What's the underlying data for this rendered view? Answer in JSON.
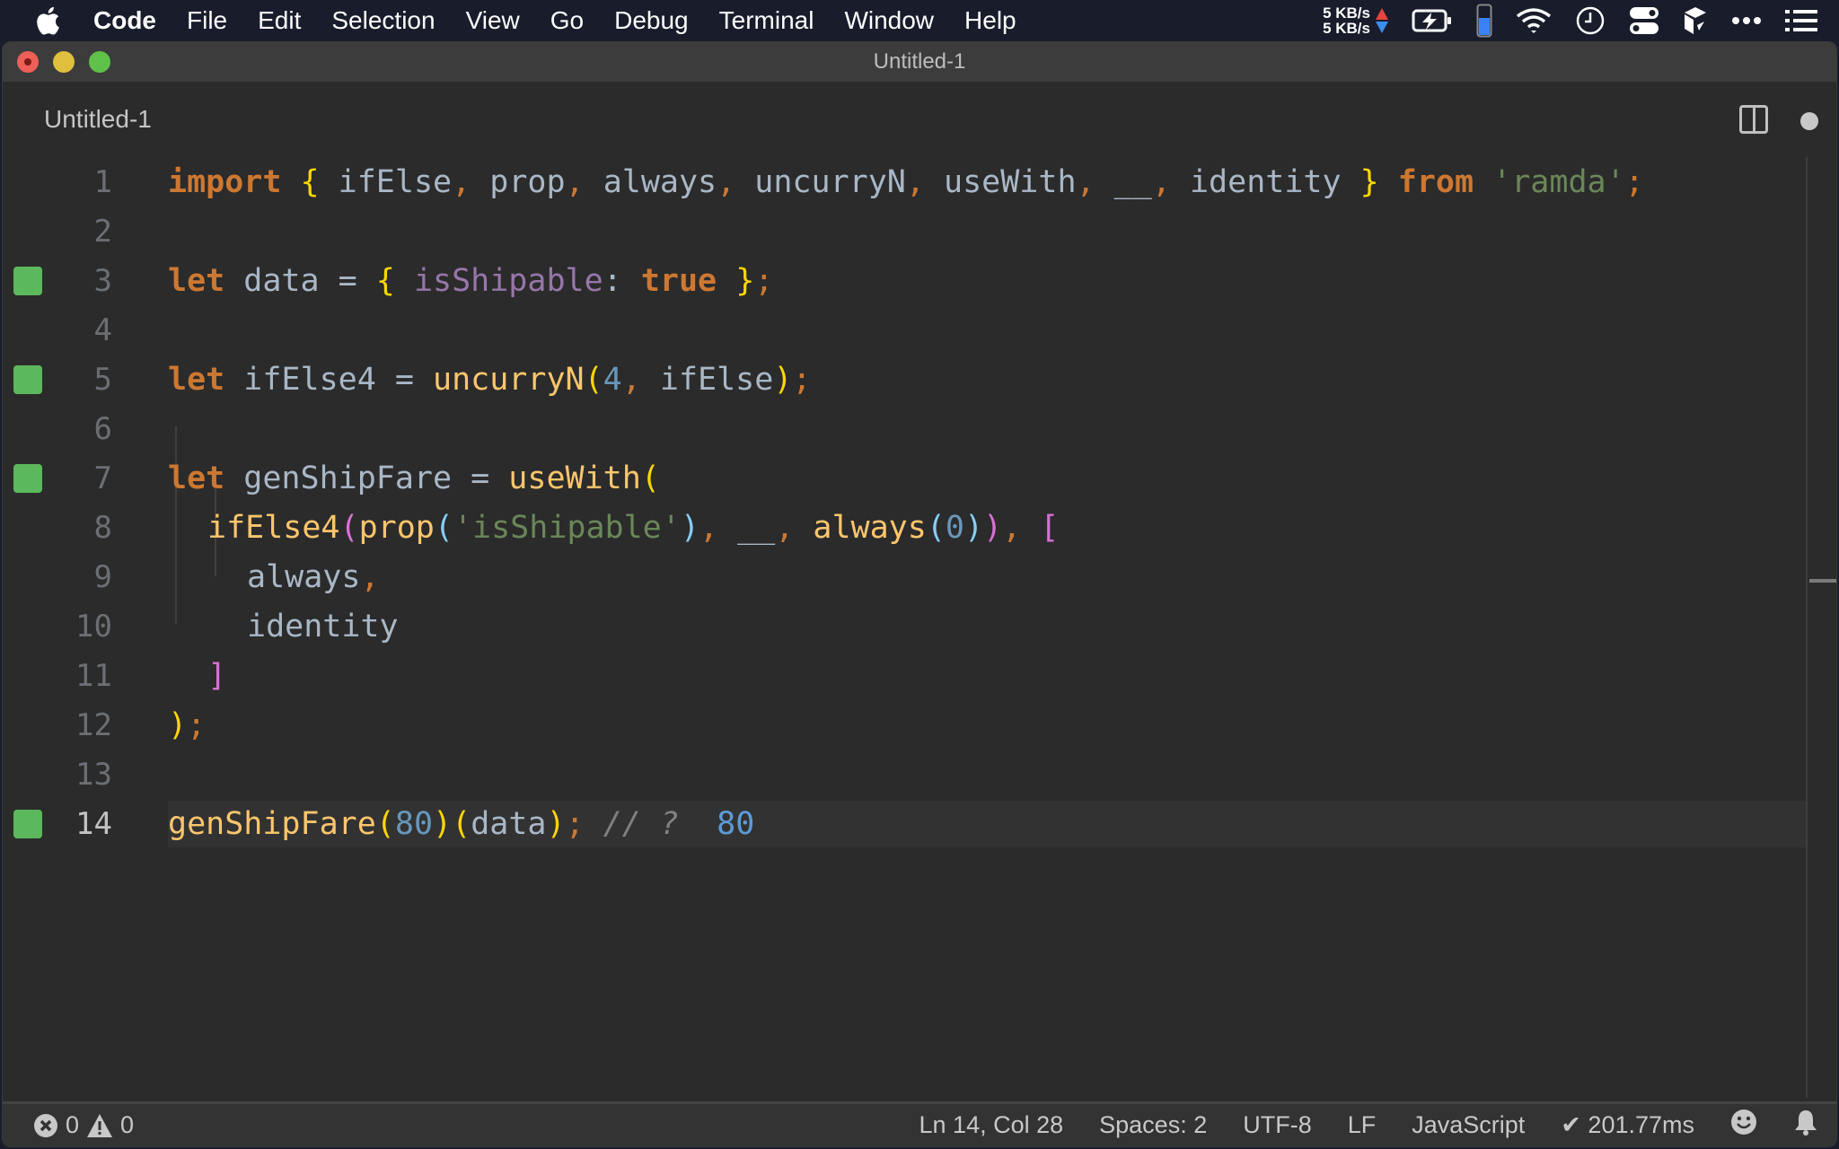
{
  "menubar": {
    "app_name": "Code",
    "items": [
      "File",
      "Edit",
      "Selection",
      "View",
      "Go",
      "Debug",
      "Terminal",
      "Window",
      "Help"
    ],
    "net_up": "5 KB/s",
    "net_down": "5 KB/s",
    "status_icons": [
      "battery-charging-icon",
      "cpu-meter-icon",
      "wifi-icon",
      "clock-icon",
      "control-center-icon",
      "app-icon",
      "more-icon",
      "list-icon"
    ]
  },
  "window": {
    "title": "Untitled-1",
    "tab_label": "Untitled-1"
  },
  "editor": {
    "lines": [
      {
        "n": "1"
      },
      {
        "n": "2"
      },
      {
        "n": "3"
      },
      {
        "n": "4"
      },
      {
        "n": "5"
      },
      {
        "n": "6"
      },
      {
        "n": "7"
      },
      {
        "n": "8"
      },
      {
        "n": "9"
      },
      {
        "n": "10"
      },
      {
        "n": "11"
      },
      {
        "n": "12"
      },
      {
        "n": "13"
      },
      {
        "n": "14"
      }
    ],
    "tokens": {
      "l1": [
        "import",
        " ",
        "{",
        " ifElse",
        ",",
        " prop",
        ",",
        " always",
        ",",
        " uncurryN",
        ",",
        " useWith",
        ",",
        " __",
        ",",
        " identity ",
        "}",
        " ",
        "from",
        " ",
        "'ramda'",
        ";"
      ],
      "l3": [
        "let",
        " data = ",
        "{",
        " ",
        "isShipable",
        ": ",
        "true",
        " ",
        "}",
        ";"
      ],
      "l5": [
        "let",
        " ifElse4 = ",
        "uncurryN",
        "(",
        "4",
        ",",
        " ifElse",
        ")",
        ";"
      ],
      "l7": [
        "let",
        " genShipFare = ",
        "useWith",
        "("
      ],
      "l8": [
        "ifElse4",
        "(",
        "prop",
        "(",
        "'isShipable'",
        ")",
        ",",
        " __",
        ",",
        " ",
        "always",
        "(",
        "0",
        ")",
        ")",
        ",",
        " ",
        "["
      ],
      "l9": [
        "always",
        ","
      ],
      "l10": [
        "identity"
      ],
      "l11": [
        "]"
      ],
      "l12": [
        ")",
        ";"
      ],
      "l14": [
        "genShipFare",
        "(",
        "80",
        ")",
        "(",
        "data",
        ")",
        ";",
        " // ?  ",
        "80"
      ]
    },
    "markers": [
      "3",
      "5",
      "7",
      "14"
    ],
    "active_line": "14"
  },
  "statusbar": {
    "errors": "0",
    "warnings": "0",
    "position": "Ln 14, Col 28",
    "indent": "Spaces: 2",
    "encoding": "UTF-8",
    "eol": "LF",
    "language": "JavaScript",
    "timing": "✔ 201.77ms"
  },
  "colors": {
    "keyword": "#cc7832",
    "function": "#ffc66d",
    "string": "#6a8759",
    "number": "#6897bb",
    "marker": "#5cb85c"
  }
}
